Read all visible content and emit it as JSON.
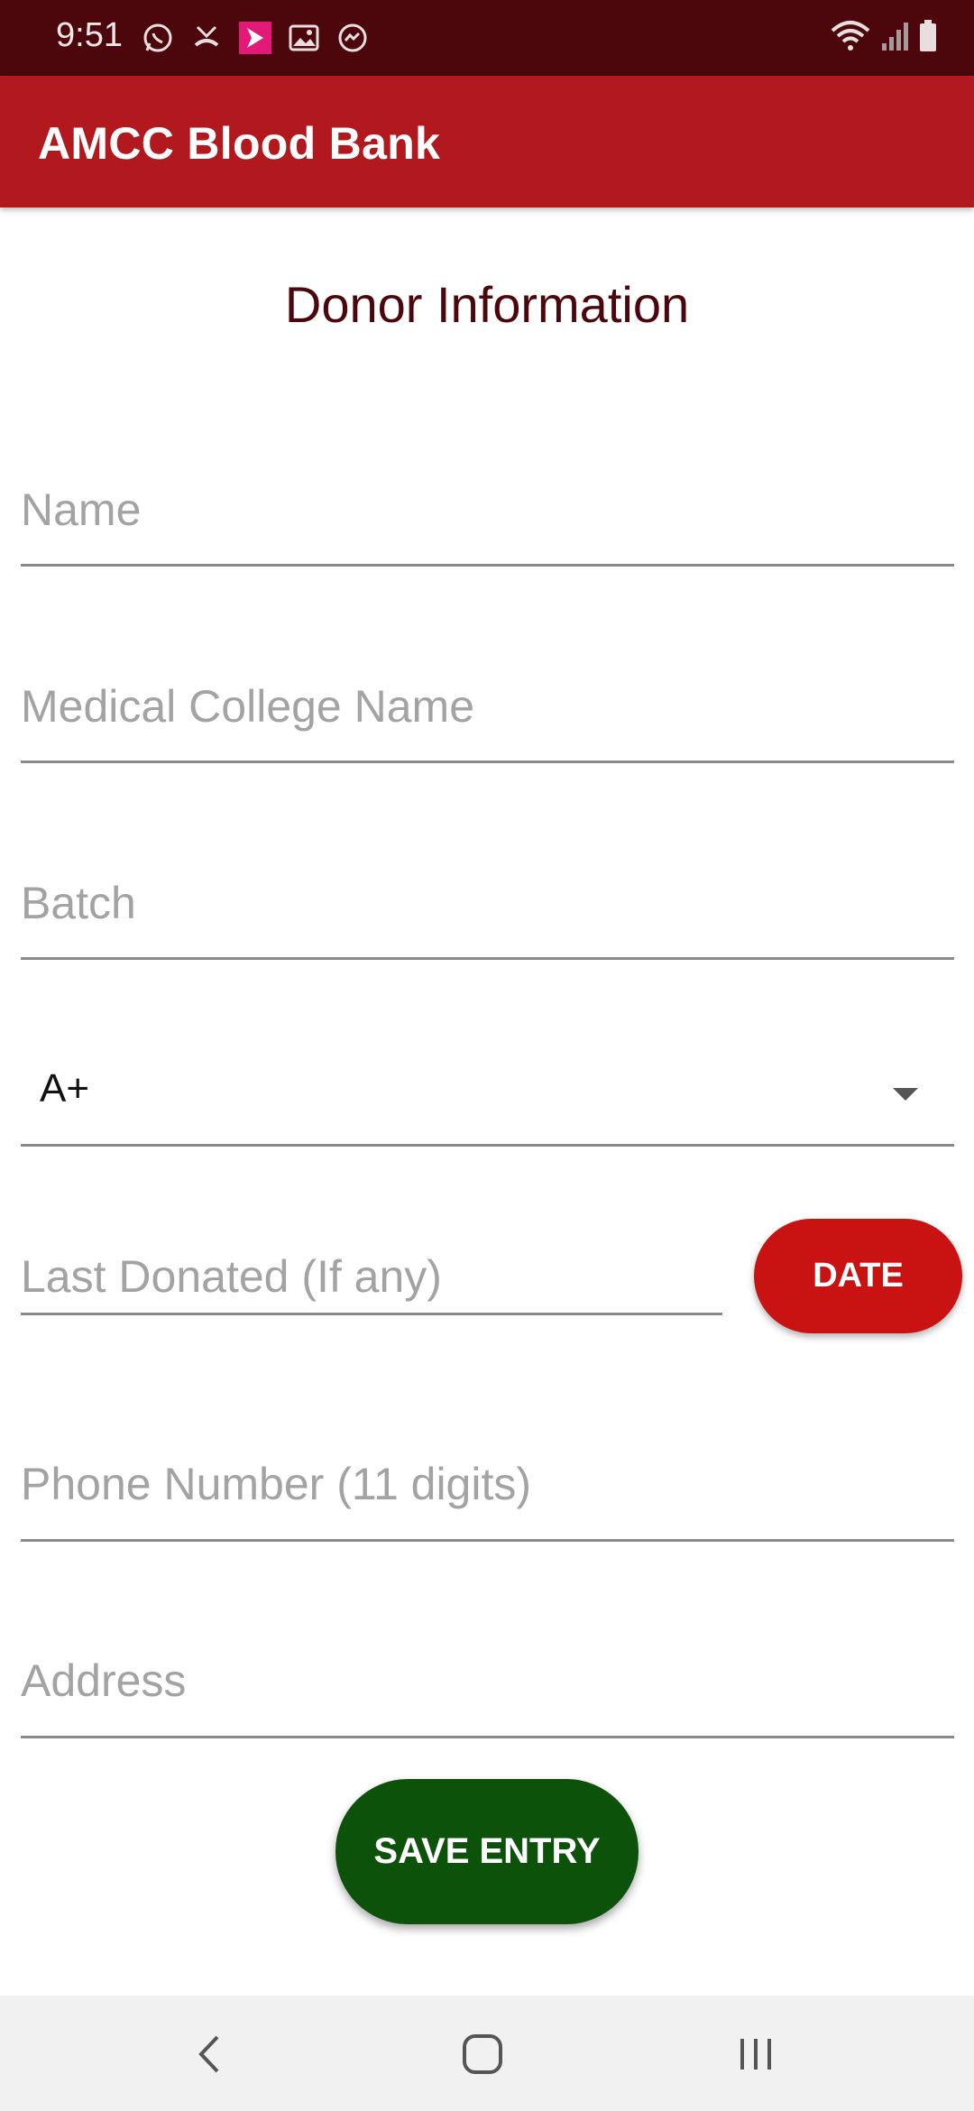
{
  "status_bar": {
    "time": "9:51",
    "icons_left": [
      "whatsapp-icon",
      "missed-call-icon",
      "app-notification-icon",
      "gallery-icon",
      "messenger-icon"
    ],
    "icons_right": [
      "wifi-icon",
      "signal-icon",
      "battery-icon"
    ]
  },
  "app_bar": {
    "title": "AMCC Blood Bank"
  },
  "form": {
    "title": "Donor Information",
    "name_placeholder": "Name",
    "college_placeholder": "Medical College Name",
    "batch_placeholder": "Batch",
    "blood_group_selected": "A+",
    "last_donated_placeholder": "Last Donated (If any)",
    "date_button_label": "DATE",
    "phone_placeholder": "Phone Number (11 digits)",
    "address_placeholder": "Address",
    "save_button_label": "SAVE ENTRY"
  },
  "nav_bar": {
    "buttons": [
      "back-icon",
      "home-icon",
      "recents-icon"
    ]
  },
  "colors": {
    "status_bar": "#4b070b",
    "app_bar": "#b2191f",
    "title_text": "#4b070b",
    "date_button": "#c91212",
    "save_button": "#0d520b",
    "nav_bar": "#f1f1f1"
  }
}
